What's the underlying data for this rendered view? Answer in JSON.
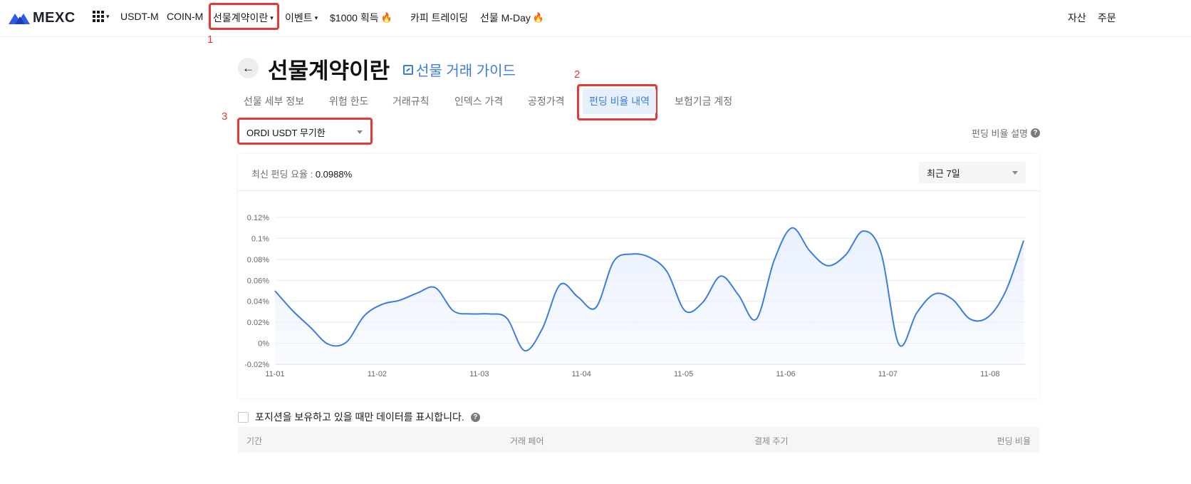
{
  "nav": {
    "logo": "MEXC",
    "items": [
      {
        "label": "USDT-M"
      },
      {
        "label": "COIN-M"
      },
      {
        "label": "선물계약이란"
      },
      {
        "label": "이벤트"
      },
      {
        "label": "$1000 획득"
      },
      {
        "label": "카피 트레이딩"
      },
      {
        "label": "선물 M-Day"
      }
    ],
    "right": [
      {
        "label": "자산"
      },
      {
        "label": "주문"
      }
    ]
  },
  "annotations": [
    "1",
    "2",
    "3"
  ],
  "header": {
    "title": "선물계약이란",
    "guide_link": "선물 거래 가이드"
  },
  "tabs": [
    {
      "label": "선물 세부 정보"
    },
    {
      "label": "위험 한도"
    },
    {
      "label": "거래규칙"
    },
    {
      "label": "인덱스 가격"
    },
    {
      "label": "공정가격"
    },
    {
      "label": "펀딩 비율 내역",
      "active": true
    },
    {
      "label": "보험기금 계정"
    }
  ],
  "selector": {
    "contract": "ORDI USDT 무기한",
    "funding_explain": "펀딩 비율 설명",
    "help": "?"
  },
  "card": {
    "latest_label": "최신 펀딩 요율 : ",
    "latest_value": "0.0988%",
    "period": "최근 7일"
  },
  "chart_data": {
    "type": "area",
    "ylim": [
      -0.02,
      0.12
    ],
    "ytick_labels": [
      "0.12%",
      "0.1%",
      "0.08%",
      "0.06%",
      "0.04%",
      "0.02%",
      "0%",
      "-0.02%"
    ],
    "xtick_labels": [
      "11-01",
      "11-02",
      "11-03",
      "11-04",
      "11-05",
      "11-06",
      "11-07",
      "11-08"
    ],
    "x": [
      1.0,
      1.2,
      1.4,
      1.6,
      1.8,
      2.0,
      2.2,
      2.4,
      2.6,
      2.8,
      3.0,
      3.2,
      3.4,
      3.6,
      3.8,
      4.0,
      4.2,
      4.4,
      4.6,
      4.8,
      5.0,
      5.2,
      5.4,
      5.6,
      5.8,
      6.0,
      6.2,
      6.4,
      6.6,
      6.8,
      7.0,
      7.2,
      7.4,
      7.6,
      7.8,
      8.0,
      8.2,
      8.33
    ],
    "series": [
      {
        "values": [
          0.05,
          0.031,
          0.015,
          -0.001,
          0.001,
          0.026,
          0.037,
          0.041,
          0.048,
          0.053,
          0.031,
          0.028,
          0.028,
          0.024,
          -0.007,
          0.014,
          0.056,
          0.044,
          0.034,
          0.078,
          0.085,
          0.082,
          0.068,
          0.031,
          0.039,
          0.064,
          0.046,
          0.023,
          0.079,
          0.11,
          0.088,
          0.074,
          0.084,
          0.107,
          0.086,
          -0.001,
          0.029,
          0.047,
          0.042,
          0.023,
          0.025,
          0.05,
          0.098
        ],
        "color": "#3b7ddd"
      }
    ],
    "grid": true,
    "fill": "#e8f0fd"
  },
  "bottom": {
    "checkbox_label": "포지션을 보유하고 있을 때만 데이터를 표시합니다.",
    "help": "?",
    "columns": [
      "기간",
      "거래 페어",
      "결제 주기",
      "펀딩 비율"
    ]
  }
}
